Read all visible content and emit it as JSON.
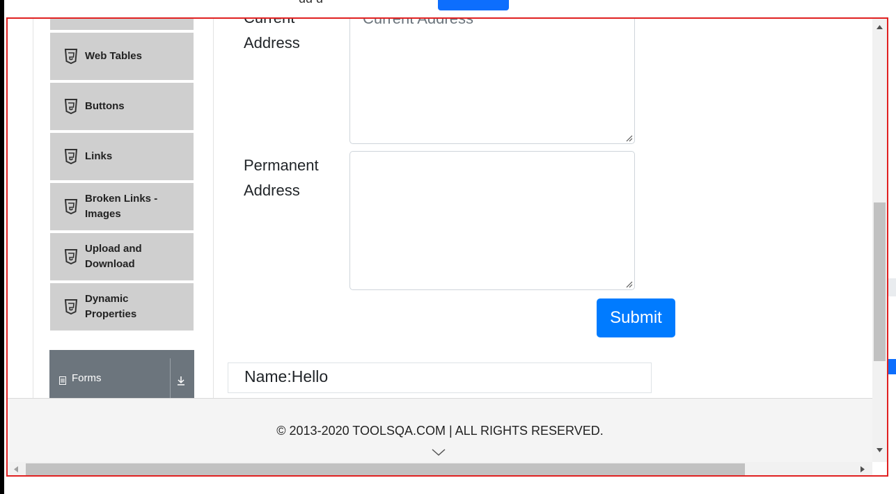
{
  "sidebar": {
    "items": [
      {
        "label": ""
      },
      {
        "label": "Web Tables"
      },
      {
        "label": "Buttons"
      },
      {
        "label": "Links"
      },
      {
        "label": "Broken Links - Images"
      },
      {
        "label": "Upload and Download"
      },
      {
        "label": "Dynamic Properties"
      }
    ],
    "forms_group": {
      "label": "Forms",
      "icon": "form-icon",
      "toggle_icon": "arrow-down-icon"
    }
  },
  "form": {
    "current_address": {
      "label": "Current Address",
      "placeholder": "Current Address",
      "value": ""
    },
    "permanent_address": {
      "label": "Permanent Address",
      "value": ""
    },
    "submit_label": "Submit"
  },
  "output": {
    "name_line": "Name:Hello"
  },
  "footer": {
    "copyright": "© 2013-2020 TOOLSQA.COM | ALL RIGHTS RESERVED."
  },
  "colors": {
    "primary": "#007bff",
    "sidebar_item_bg": "#cfcfcf",
    "forms_group_bg": "#6c757d",
    "frame_border": "#e02020"
  }
}
